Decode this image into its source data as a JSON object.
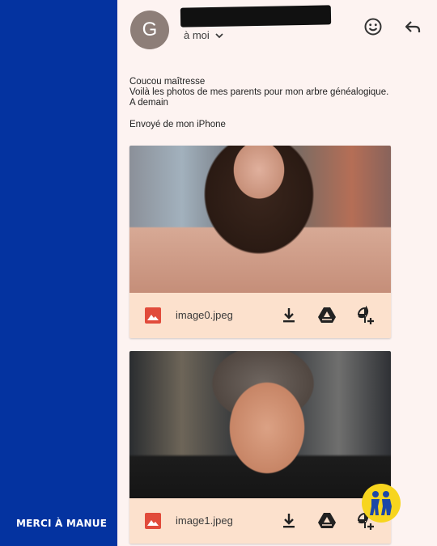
{
  "overlay": {
    "credit": "MERCI À MANUE"
  },
  "email": {
    "avatar_letter": "G",
    "recipient": "à moi",
    "body_lines": [
      "Coucou maîtresse",
      "Voilà les photos de mes parents pour mon arbre généalogique.",
      "A demain"
    ],
    "signature": "Envoyé de mon iPhone"
  },
  "attachments": [
    {
      "name": "image0.jpeg"
    },
    {
      "name": "image1.jpeg"
    }
  ],
  "icons": {
    "header": [
      "emoji-icon",
      "reply-icon"
    ],
    "attachment_actions": [
      "download-icon",
      "google-drive-icon",
      "add-to-photos-icon"
    ],
    "file": "image-file-icon"
  },
  "colors": {
    "side_band": "#0433a0",
    "card": "#fce1cd",
    "file_icon": "#e14b3b",
    "badge": "#f7d51e"
  }
}
